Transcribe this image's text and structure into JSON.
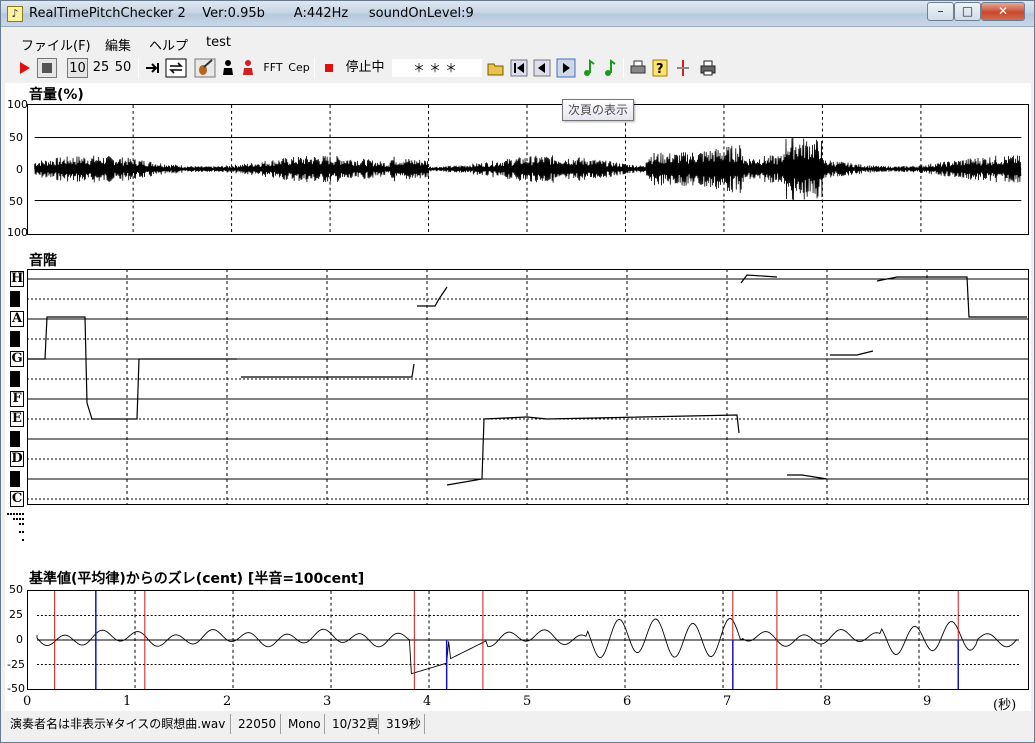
{
  "window": {
    "title": "RealTimePitchChecker 2    Ver:0.95b       A:442Hz     soundOnLevel:9",
    "controls": {
      "minimize": "–",
      "maximize": "□",
      "close": "✕"
    }
  },
  "menu": [
    "ファイル(F)",
    "編集",
    "ヘルプ",
    "test"
  ],
  "toolbar": {
    "speed_10": "10",
    "speed_25": "25",
    "speed_50": "50",
    "fft_label": "FFT",
    "cep_label": "Cep",
    "status_label": "停止中",
    "status_field": "＊＊＊",
    "icons": [
      "play-icon",
      "stop-icon",
      "speed-10",
      "speed-25",
      "speed-50",
      "jump-end-icon",
      "loop-icon",
      "violin-icon",
      "person-icon",
      "person-red-icon",
      "fft",
      "cep",
      "record-icon",
      "status",
      "folder-open-icon",
      "first-page-icon",
      "prev-page-icon",
      "next-page-icon",
      "note-green-icon",
      "note-green2-icon",
      "print-icon",
      "help-icon",
      "marker-icon",
      "printer-icon"
    ]
  },
  "tooltip": "次頁の表示",
  "volume_panel": {
    "label": "音量(%)",
    "y_labels": [
      "100",
      "50",
      "0",
      "50",
      "100"
    ]
  },
  "scale_panel": {
    "label": "音階",
    "notes": [
      "H",
      "A",
      "G",
      "F",
      "E",
      "D",
      "C"
    ]
  },
  "deviation_panel": {
    "label": "基準値(平均律)からのズレ(cent) [半音=100cent]",
    "y_labels": [
      "50",
      "25",
      "0",
      "-25",
      "-50"
    ]
  },
  "time_axis": {
    "labels": [
      "0",
      "1",
      "2",
      "3",
      "4",
      "5",
      "6",
      "7",
      "8",
      "9"
    ],
    "unit": "(秒)"
  },
  "statusbar": {
    "file": "演奏者名は非表示¥タイスの瞑想曲.wav",
    "rate": "22050",
    "channels": "Mono",
    "page": "10/32頁",
    "duration": "319秒"
  }
}
